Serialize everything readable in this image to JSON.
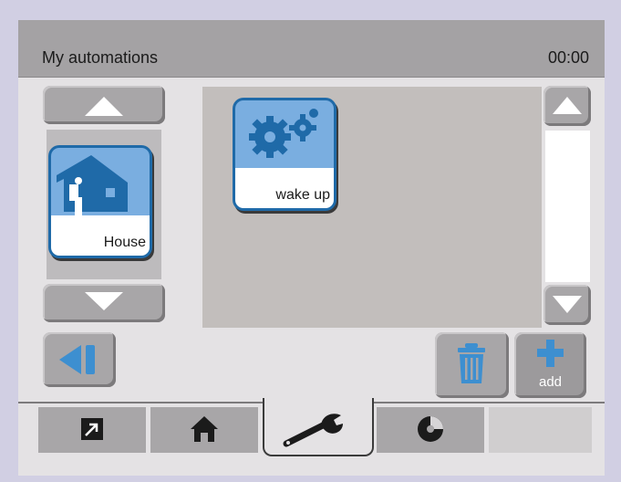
{
  "header": {
    "title": "My automations",
    "clock": "00:00"
  },
  "categories": [
    {
      "label": "House",
      "icon": "house-icon"
    }
  ],
  "automations": [
    {
      "label": "wake up",
      "icon": "gears-icon"
    }
  ],
  "actions": {
    "add_label": "add",
    "delete_icon": "trash-icon",
    "back_icon": "back-icon"
  },
  "tabs": [
    {
      "icon": "shortcut-arrow-icon",
      "active": false
    },
    {
      "icon": "home-icon",
      "active": false
    },
    {
      "icon": "wrench-icon",
      "active": true
    },
    {
      "icon": "disc-icon",
      "active": false
    },
    {
      "icon": "",
      "active": false
    }
  ],
  "colors": {
    "accent_blue": "#3d8fd0",
    "tile_dark_blue": "#1f6aa8",
    "tile_light_blue": "#7aaee0",
    "button_gray": "#a8a6a8",
    "title_bar": "#a4a2a4"
  }
}
